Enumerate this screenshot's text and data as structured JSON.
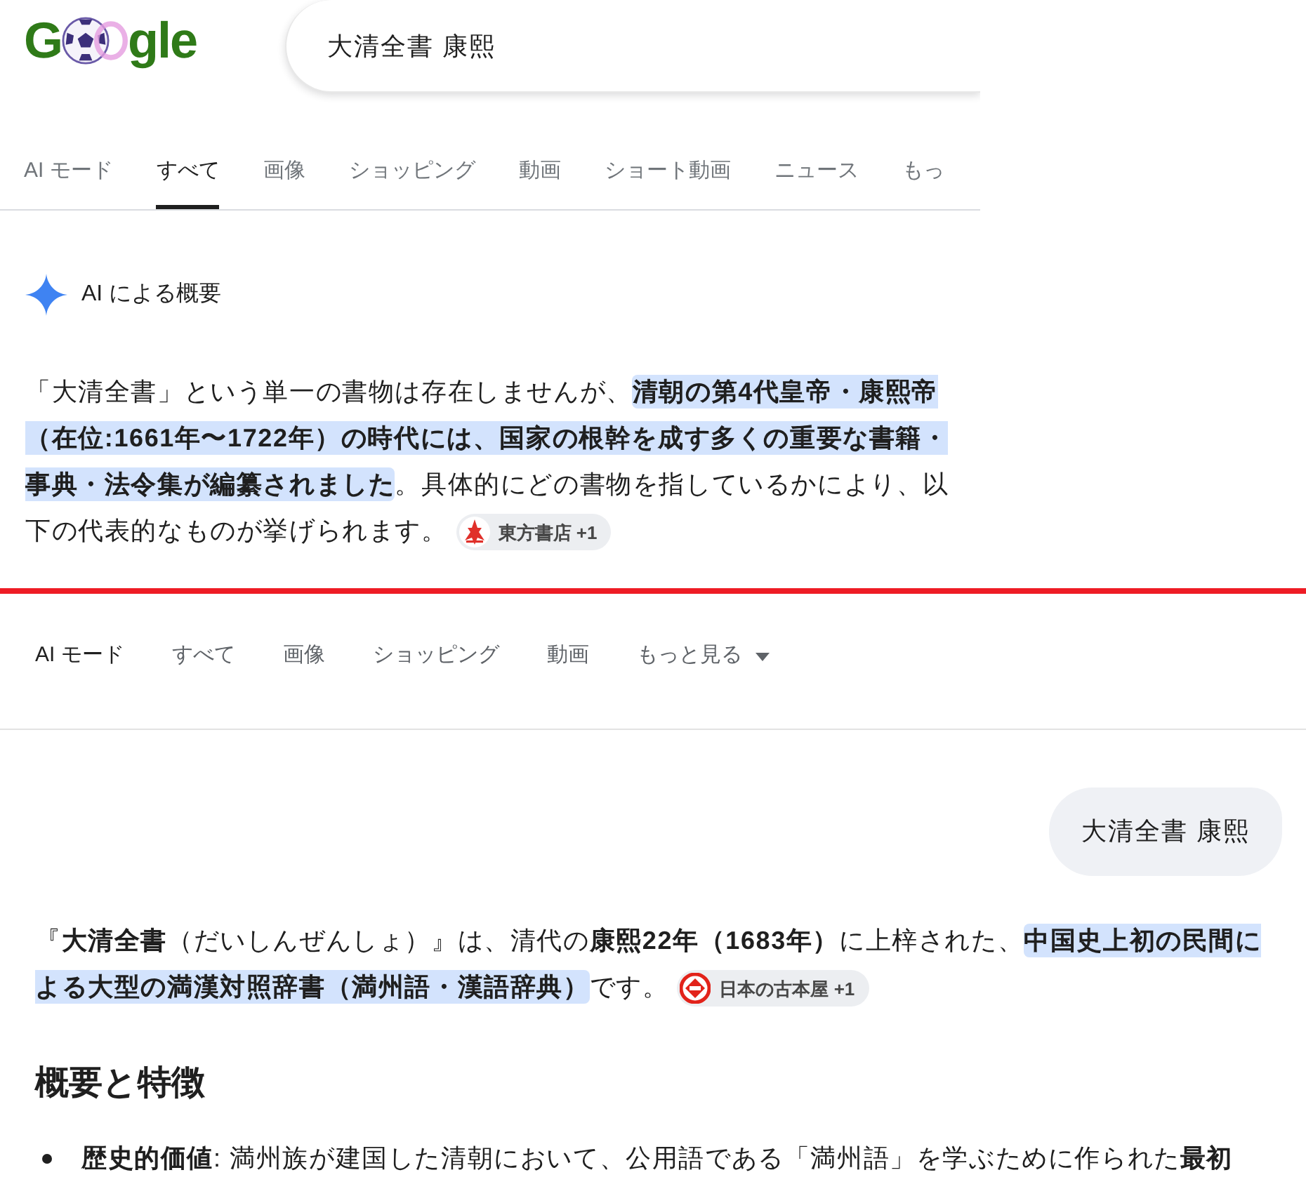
{
  "top_screen": {
    "logo": {
      "left_letters": "G",
      "right_letters": "gle"
    },
    "search": {
      "value": "大清全書 康熙"
    },
    "tabs": [
      {
        "label": "AI モード",
        "selected": false
      },
      {
        "label": "すべて",
        "selected": true
      },
      {
        "label": "画像",
        "selected": false
      },
      {
        "label": "ショッピング",
        "selected": false
      },
      {
        "label": "動画",
        "selected": false
      },
      {
        "label": "ショート動画",
        "selected": false
      },
      {
        "label": "ニュース",
        "selected": false
      },
      {
        "label": "もっ",
        "selected": false
      }
    ],
    "ai_overview": {
      "title": "AI による概要",
      "paragraph": [
        {
          "text": "「大清全書」という単一の書物は存在しませんが、",
          "highlighted": false
        },
        {
          "text": "清朝の第4代皇帝・康熙帝（在位:1661年〜1722年）の時代には、国家の根幹を成す多くの重要な書籍・事典・法令集が編纂されました",
          "highlighted": true
        },
        {
          "text": "。具体的にどの書物を指しているかにより、以下の代表的なものが挙げられます。",
          "highlighted": false
        }
      ],
      "source_chip": {
        "label": "東方書店 +1"
      }
    }
  },
  "bottom_screen": {
    "tabs": [
      {
        "label": "AI モード",
        "selected": true,
        "kind": "tab"
      },
      {
        "label": "すべて",
        "selected": false,
        "kind": "tab"
      },
      {
        "label": "画像",
        "selected": false,
        "kind": "tab"
      },
      {
        "label": "ショッピング",
        "selected": false,
        "kind": "tab"
      },
      {
        "label": "動画",
        "selected": false,
        "kind": "tab"
      },
      {
        "label": "もっと見る",
        "selected": false,
        "kind": "dropdown"
      }
    ],
    "query": "大清全書 康熙",
    "answer": {
      "paragraph": [
        {
          "text": "『**大清全書**（だいしんぜんしょ）』は、清代の**康熙22年（1683年）**に上梓された、",
          "highlighted": false
        },
        {
          "text": "中国史上初の民間による大型の満漢対照辞書（満州語・漢語辞典）",
          "highlighted": true
        },
        {
          "text": "です。",
          "highlighted": false
        }
      ],
      "source_chip": {
        "label": "日本の古本屋 +1"
      }
    },
    "section": {
      "heading": "概要と特徴",
      "bullets": [
        "**歴史的価値**: 満州族が建国した清朝において、公用語である「満州語」を学ぶために作られた**最初**"
      ]
    }
  }
}
